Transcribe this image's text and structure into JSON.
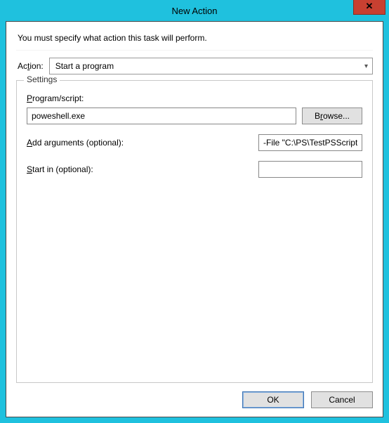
{
  "window": {
    "title": "New Action",
    "close_glyph": "✕"
  },
  "instruction": "You must specify what action this task will perform.",
  "action": {
    "label_prefix": "Ac",
    "label_ul": "t",
    "label_suffix": "ion:",
    "selected": "Start a program"
  },
  "settings": {
    "legend": "Settings",
    "program": {
      "label_ul": "P",
      "label_rest": "rogram/script:",
      "value": "poweshell.exe",
      "browse_ul": "r",
      "browse_prefix": "B",
      "browse_suffix": "owse..."
    },
    "arguments": {
      "label_ul": "A",
      "label_rest": "dd arguments (optional):",
      "value": "-File \"C:\\PS\\TestPSScript"
    },
    "startin": {
      "label_ul": "S",
      "label_rest": "tart in (optional):",
      "value": ""
    }
  },
  "buttons": {
    "ok": "OK",
    "cancel": "Cancel"
  }
}
